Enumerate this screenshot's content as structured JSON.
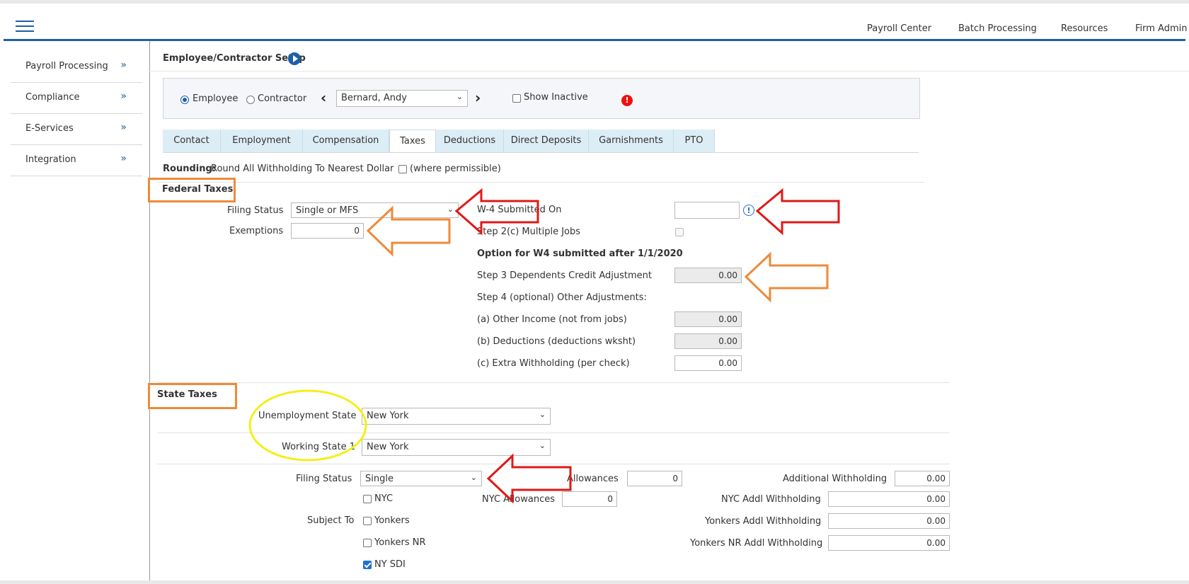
{
  "topnav": {
    "items": [
      "Payroll Center",
      "Batch Processing",
      "Resources",
      "Firm Admin"
    ]
  },
  "sidebar": {
    "items": [
      {
        "label": "Payroll Processing",
        "chev": "»"
      },
      {
        "label": "Compliance",
        "chev": "»"
      },
      {
        "label": "E-Services",
        "chev": "»"
      },
      {
        "label": "Integration",
        "chev": "»"
      }
    ]
  },
  "page": {
    "title": "Employee/Contractor Setup"
  },
  "employee_bar": {
    "employee_label": "Employee",
    "contractor_label": "Contractor",
    "selected_type": "Employee",
    "selected_employee": "Bernard, Andy",
    "show_inactive_label": "Show Inactive",
    "alert": "!"
  },
  "tabs": [
    {
      "label": "Contact"
    },
    {
      "label": "Employment"
    },
    {
      "label": "Compensation"
    },
    {
      "label": "Taxes",
      "active": true
    },
    {
      "label": "Deductions"
    },
    {
      "label": "Direct Deposits"
    },
    {
      "label": "Garnishments"
    },
    {
      "label": "PTO"
    }
  ],
  "rounding": {
    "label": "Rounding:",
    "text": "Round All Withholding To Nearest Dollar",
    "note": "(where permissible)"
  },
  "federal": {
    "heading": "Federal Taxes",
    "filing_status_label": "Filing Status",
    "filing_status": "Single or MFS",
    "exemptions_label": "Exemptions",
    "exemptions": "0",
    "w4_label": "W-4 Submitted On",
    "w4_value": "",
    "step2c_label": "Step 2(c) Multiple Jobs",
    "option_heading": "Option for W4 submitted after 1/1/2020",
    "step3_label": "Step 3 Dependents Credit Adjustment",
    "step3_value": "0.00",
    "step4_label": "Step 4 (optional) Other Adjustments:",
    "other_income_label": "(a) Other Income (not from jobs)",
    "other_income": "0.00",
    "deductions_label": "(b) Deductions (deductions wksht)",
    "deductions": "0.00",
    "extra_label": "(c) Extra Withholding (per check)",
    "extra": "0.00",
    "info": "!"
  },
  "state": {
    "heading": "State Taxes",
    "unemp_label": "Unemployment State",
    "unemp_value": "New York",
    "working1_label": "Working State 1",
    "working1_value": "New York",
    "filing_status_label": "Filing Status",
    "filing_status": "Single",
    "allowances_label": "Allowances",
    "allowances": "0",
    "addl_label": "Additional Withholding",
    "addl": "0.00",
    "subject_label": "Subject To",
    "nyc_label": "NYC",
    "yonkers_label": "Yonkers",
    "yonkers_nr_label": "Yonkers NR",
    "nysdi_label": "NY SDI",
    "nyc_allow_label": "NYC Allowances",
    "nyc_allow": "0",
    "nyc_addl_label": "NYC Addl Withholding",
    "nyc_addl": "0.00",
    "yonkers_addl_label": "Yonkers Addl Withholding",
    "yonkers_addl": "0.00",
    "yonkers_nr_addl_label": "Yonkers NR Addl Withholding",
    "yonkers_nr_addl": "0.00"
  },
  "colors": {
    "brand": "#1f5fa8",
    "annotation_red": "#e11818",
    "annotation_orange": "#ee8a3a",
    "annotation_yellow": "#f5ee1a"
  }
}
